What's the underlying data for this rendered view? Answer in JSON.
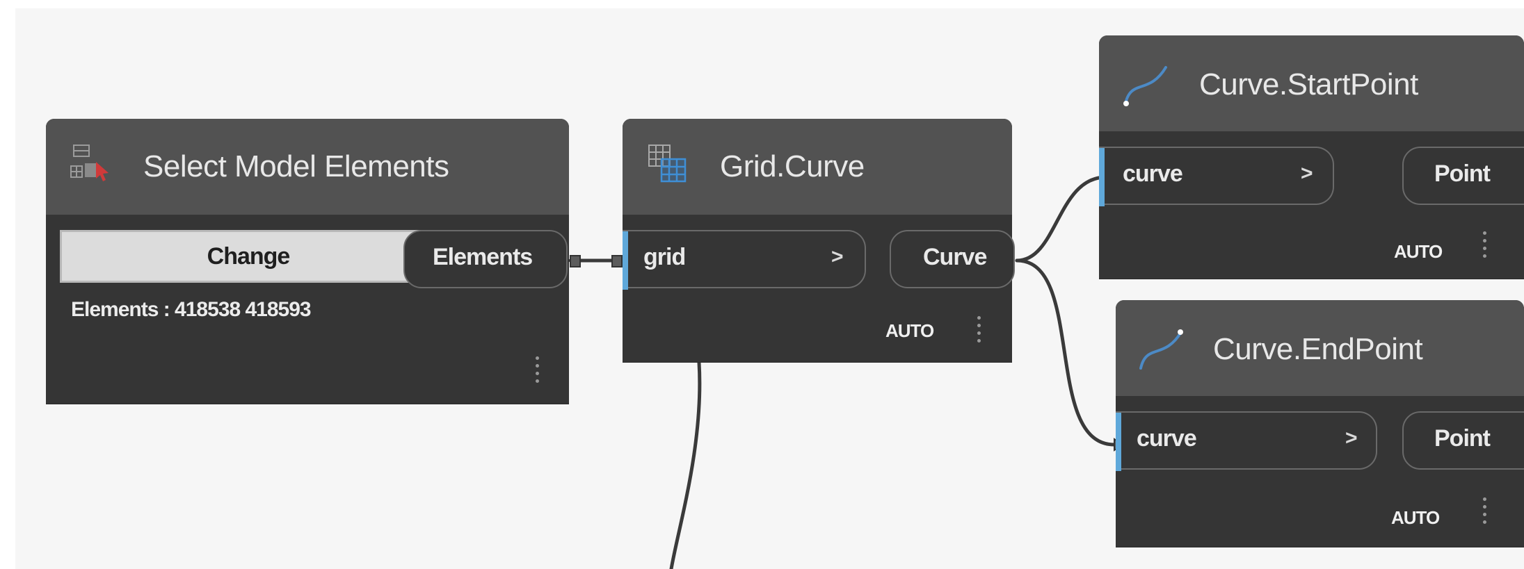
{
  "nodes": {
    "select": {
      "title": "Select Model Elements",
      "button": "Change",
      "output": "Elements",
      "info": "Elements : 418538 418593"
    },
    "grid_curve": {
      "title": "Grid.Curve",
      "input": "grid",
      "input_chevron": ">",
      "output": "Curve",
      "lacing": "AUTO"
    },
    "start_point": {
      "title": "Curve.StartPoint",
      "input": "curve",
      "input_chevron": ">",
      "output": "Point",
      "lacing": "AUTO"
    },
    "end_point": {
      "title": "Curve.EndPoint",
      "input": "curve",
      "input_chevron": ">",
      "output": "Point",
      "lacing": "AUTO"
    }
  },
  "colors": {
    "canvas": "#f6f6f6",
    "node_body": "#353535",
    "node_header": "#525252",
    "port_accent": "#5fa8da",
    "wire": "#3c3c3c"
  },
  "icons": [
    "selection-icon",
    "grid-icon",
    "curve-icon"
  ]
}
